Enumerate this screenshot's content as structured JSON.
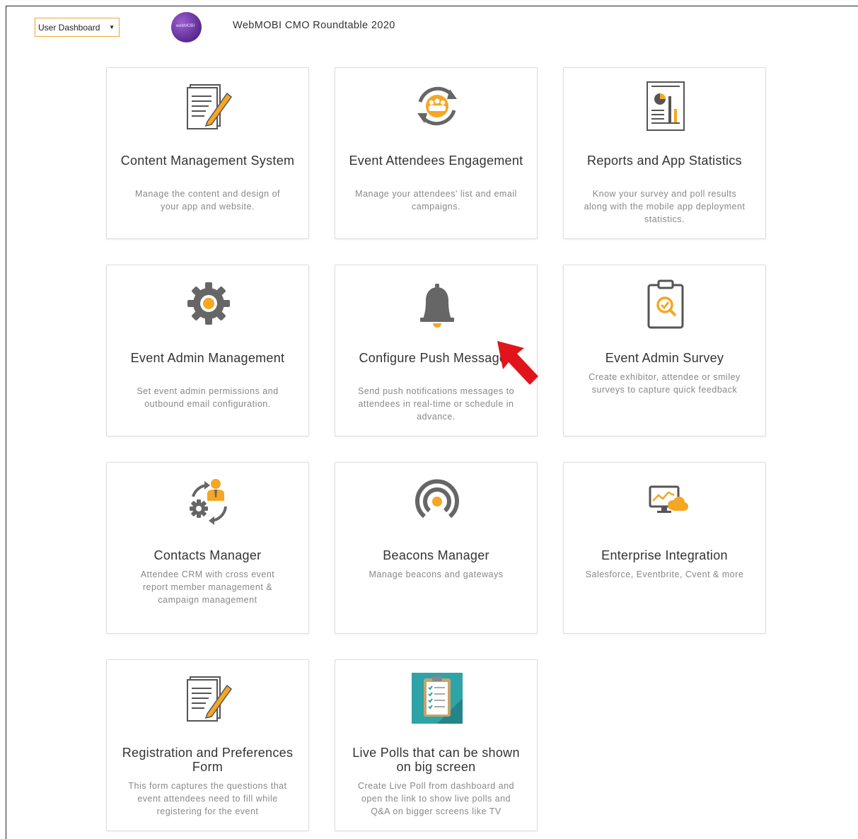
{
  "header": {
    "dashboard_select": {
      "value": "User Dashboard"
    },
    "event_title": "WebMOBI CMO Roundtable 2020",
    "logo_text": "webMOBI"
  },
  "colors": {
    "accent": "#f5a623",
    "icon_gray": "#666666",
    "arrow": "#e0141a"
  },
  "cards": [
    {
      "title": "Content Management System",
      "desc": "Manage the content and design of your app and website.",
      "icon": "document-edit-icon"
    },
    {
      "title": "Event Attendees Engagement",
      "desc": "Manage your attendees' list and email campaigns.",
      "icon": "attendees-refresh-icon"
    },
    {
      "title": "Reports and App Statistics",
      "desc": "Know your survey and poll results along with the mobile app deployment statistics.",
      "icon": "report-chart-icon"
    },
    {
      "title": "Event Admin Management",
      "desc": "Set event admin permissions and outbound email configuration.",
      "icon": "gear-icon"
    },
    {
      "title": "Configure Push Messages",
      "desc": "Send push notifications messages to attendees in real-time or schedule in advance.",
      "icon": "bell-icon"
    },
    {
      "title": "Event Admin Survey",
      "desc": "Create exhibitor, attendee or smiley surveys to capture quick feedback",
      "icon": "clipboard-search-icon"
    },
    {
      "title": "Contacts Manager",
      "desc": "Attendee CRM with cross event report member management & campaign management",
      "icon": "contact-sync-icon"
    },
    {
      "title": "Beacons Manager",
      "desc": "Manage beacons and gateways",
      "icon": "beacon-icon"
    },
    {
      "title": "Enterprise Integration",
      "desc": "Salesforce, Eventbrite, Cvent & more",
      "icon": "monitor-cloud-icon"
    },
    {
      "title": "Registration and Preferences Form",
      "desc": "This form captures the questions that event attendees need to fill while registering for the event",
      "icon": "document-edit-icon"
    },
    {
      "title": "Live Polls that can be shown on big screen",
      "desc": "Create Live Poll from dashboard and open the link to show live polls and Q&A on bigger screens like TV",
      "icon": "checklist-clipboard-icon"
    }
  ]
}
